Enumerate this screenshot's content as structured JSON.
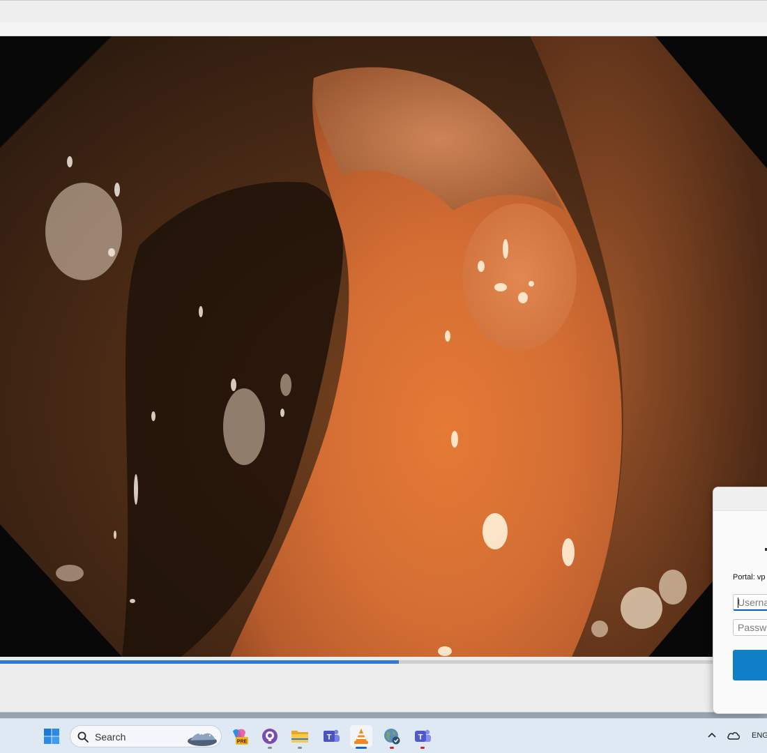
{
  "player": {
    "progress_fraction": 0.52
  },
  "vpn_login": {
    "portal_text": "Portal: vp",
    "username_placeholder": "Userna",
    "password_placeholder": "Passwo"
  },
  "taskbar": {
    "search_label": "Search",
    "pinned_apps": [
      {
        "icon": "windows-start-icon"
      },
      {
        "icon": "copilot-pre-icon"
      },
      {
        "icon": "github-icon"
      },
      {
        "icon": "file-explorer-icon"
      },
      {
        "icon": "teams-classic-icon"
      },
      {
        "icon": "vlc-icon",
        "active": true
      },
      {
        "icon": "vpn-globe-icon"
      },
      {
        "icon": "teams-icon"
      }
    ],
    "tray": {
      "language": "ENG"
    }
  },
  "colors": {
    "accent": "#2c7cd6",
    "connect_button": "#0f7fc8",
    "taskbar": "#dfe9f3"
  }
}
